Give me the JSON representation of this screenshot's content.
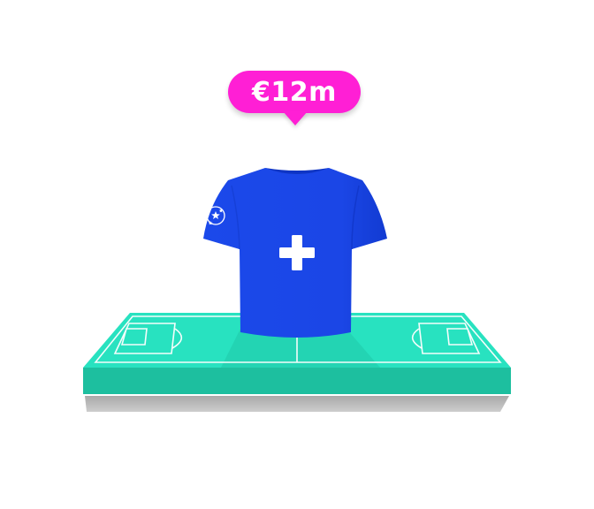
{
  "price": {
    "label": "€12m"
  },
  "icons": {
    "add": "plus-icon",
    "competition": "champions-league-star-ball-icon",
    "shirt": "football-shirt-icon",
    "pitch": "football-pitch-icon"
  },
  "colors": {
    "badge": "#ff1fd5",
    "shirt": "#1a47e8",
    "pitch": "#25e0bf",
    "pitch_edge": "#1cc0a1"
  }
}
